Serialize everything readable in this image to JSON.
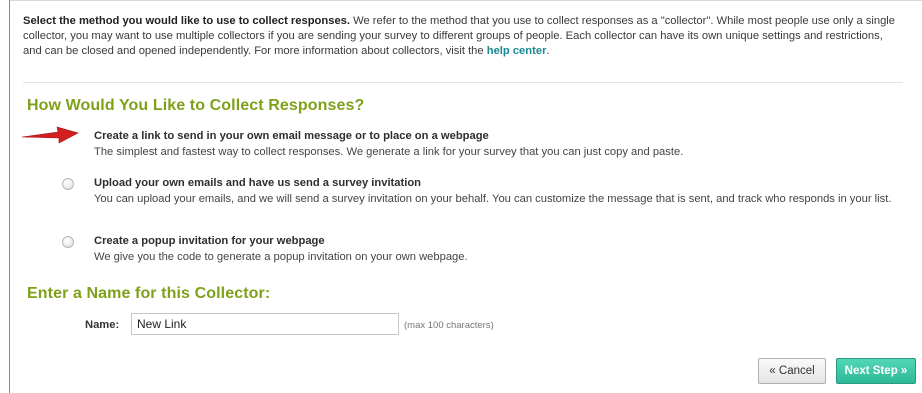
{
  "intro": {
    "lead_bold": "Select the method you would like to use to collect responses.",
    "body": " We refer to the method that you use to collect responses as a \"collector\". While most people use only a single collector, you may want to use multiple collectors if you are sending your survey to different groups of people. Each collector can have its own unique settings and restrictions, and can be closed and opened independently.  For more information about collectors, visit the ",
    "link": "help center",
    "end": "."
  },
  "collect_section": {
    "title": "How Would You Like to Collect Responses?",
    "options": [
      {
        "title": "Create a link to send in your own email message or to place on a webpage",
        "desc": "The simplest and fastest way to collect responses. We generate a link for your survey that you can just copy and paste."
      },
      {
        "title": "Upload your own emails and have us send a survey invitation",
        "desc": "You can upload your emails, and we will send a survey invitation on your behalf. You can customize the message that is sent, and track who responds in your list."
      },
      {
        "title": "Create a popup invitation for your webpage",
        "desc": "We give you the code to generate a popup invitation on your own webpage."
      }
    ]
  },
  "name_section": {
    "title": "Enter a Name for this Collector:",
    "label": "Name:",
    "value": "New Link",
    "hint": "(max 100 characters)"
  },
  "buttons": {
    "cancel": "« Cancel",
    "next": "Next Step »"
  },
  "colors": {
    "section_title": "#7fa11a",
    "link": "#1a8a93",
    "next_button": "#3cc8a6",
    "arrow": "#d21f1f"
  },
  "icons": {
    "pointer_arrow": "red-arrow-icon"
  }
}
